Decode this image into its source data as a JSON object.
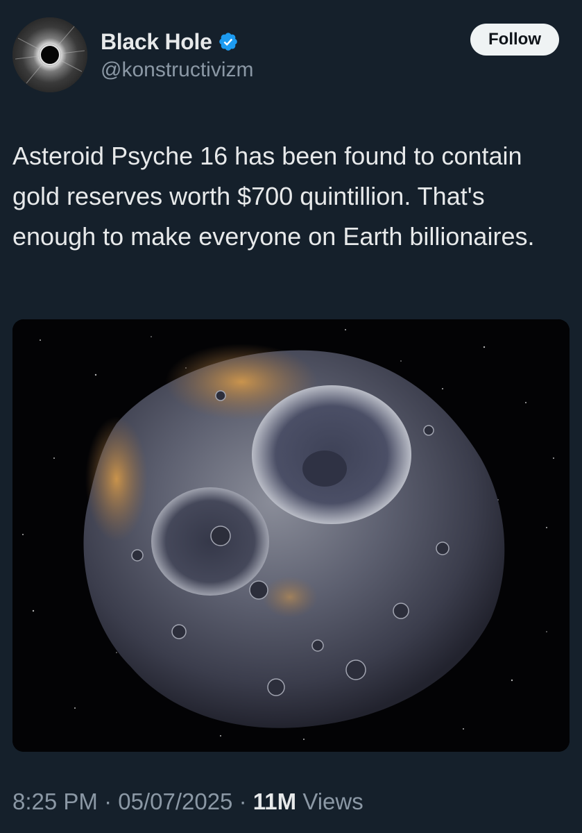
{
  "author": {
    "display_name": "Black Hole",
    "handle": "@konstructivizm",
    "verified": true,
    "avatar_icon": "black-hole-avatar"
  },
  "follow_button": {
    "label": "Follow"
  },
  "tweet": {
    "text": "Asteroid Psyche 16 has been found to contain gold reserves worth $700 quintillion. That's enough to make everyone on Earth billionaires.",
    "media": {
      "alt": "Illustration of asteroid Psyche 16 against a starry background"
    }
  },
  "meta": {
    "time": "8:25 PM",
    "separator": "·",
    "date": "05/07/2025",
    "views_count": "11M",
    "views_label": "Views"
  },
  "colors": {
    "background": "#15202b",
    "text_primary": "#e7e9ea",
    "text_secondary": "#8b98a5",
    "verified_blue": "#1d9bf0",
    "follow_bg": "#eff3f4"
  }
}
